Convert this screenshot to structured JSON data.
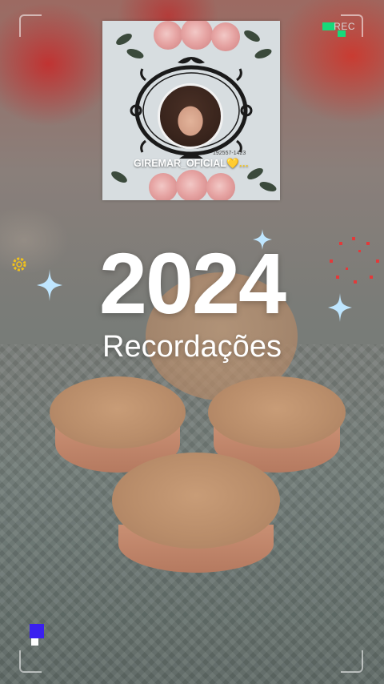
{
  "recording": {
    "label": "REC",
    "indicator_color": "#17d97a"
  },
  "profile": {
    "handle": "GIREMAR_OFICIAL",
    "handle_suffix": "💛…",
    "card_number": "192557-1423"
  },
  "headline": {
    "year": "2024",
    "subtitle": "Recordações"
  },
  "colors": {
    "text": "#ffffff",
    "sparkle": "#9fd8ff",
    "sun_ring": "#f2c21a",
    "red_ring": "#e23a3a",
    "blue_square": "#3a1ff0"
  },
  "icons": [
    "sparkle-icon",
    "sun-ring-icon",
    "red-dotted-ring-icon"
  ]
}
